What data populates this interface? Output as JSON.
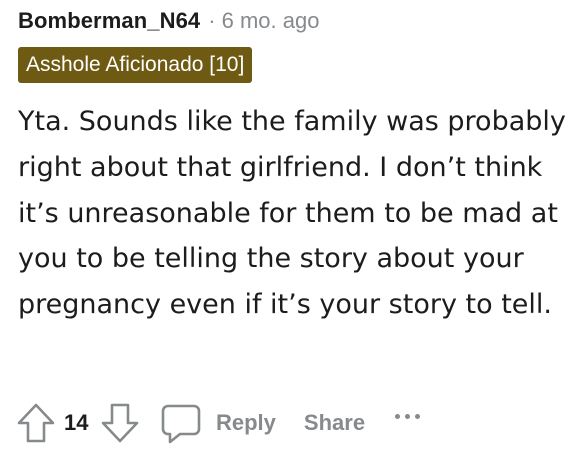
{
  "comment": {
    "username": "Bomberman_N64",
    "separator": "·",
    "timestamp": "6 mo. ago",
    "flair": "Asshole Aficionado [10]",
    "body": "Yta. Sounds like the family was probably right about that girlfriend. I don’t think it’s unreasonable for them to be mad at you to be telling the story about your pregnancy even if it’s your story to tell.",
    "score": "14",
    "actions": {
      "reply_label": "Reply",
      "share_label": "Share"
    }
  },
  "icons": {
    "upvote": "upvote-arrow-icon",
    "downvote": "downvote-arrow-icon",
    "reply": "speech-bubble-icon",
    "more": "more-options-icon"
  },
  "colors": {
    "flair_background": "#6e5a12",
    "muted": "#878a8c",
    "text": "#1c1c1c"
  }
}
